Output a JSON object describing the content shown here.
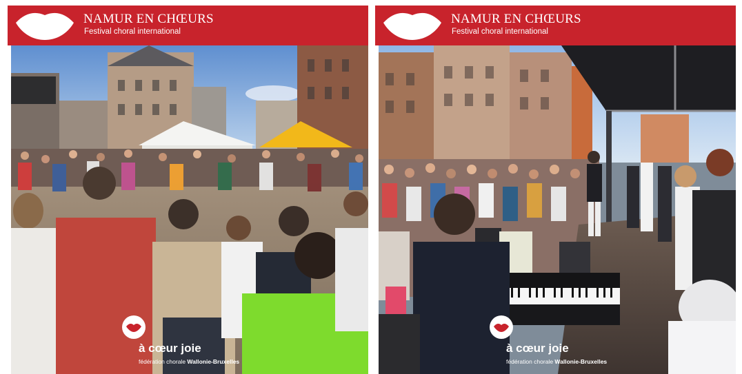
{
  "panels": [
    {
      "banner": {
        "title": "NAMUR EN CHŒURS",
        "subtitle": "Festival choral international"
      },
      "photo": {
        "description_icon": "crowd-square-photo"
      },
      "brand": {
        "name": "à cœur joie",
        "tagline_prefix": "fédération chorale ",
        "tagline_region": "Wallonie-Bruxelles"
      }
    },
    {
      "banner": {
        "title": "NAMUR EN CHŒURS",
        "subtitle": "Festival choral international"
      },
      "photo": {
        "description_icon": "stage-piano-photo"
      },
      "brand": {
        "name": "à cœur joie",
        "tagline_prefix": "fédération chorale ",
        "tagline_region": "Wallonie-Bruxelles"
      }
    }
  ],
  "colors": {
    "banner_red": "#c8232c",
    "logo_white": "#ffffff"
  }
}
